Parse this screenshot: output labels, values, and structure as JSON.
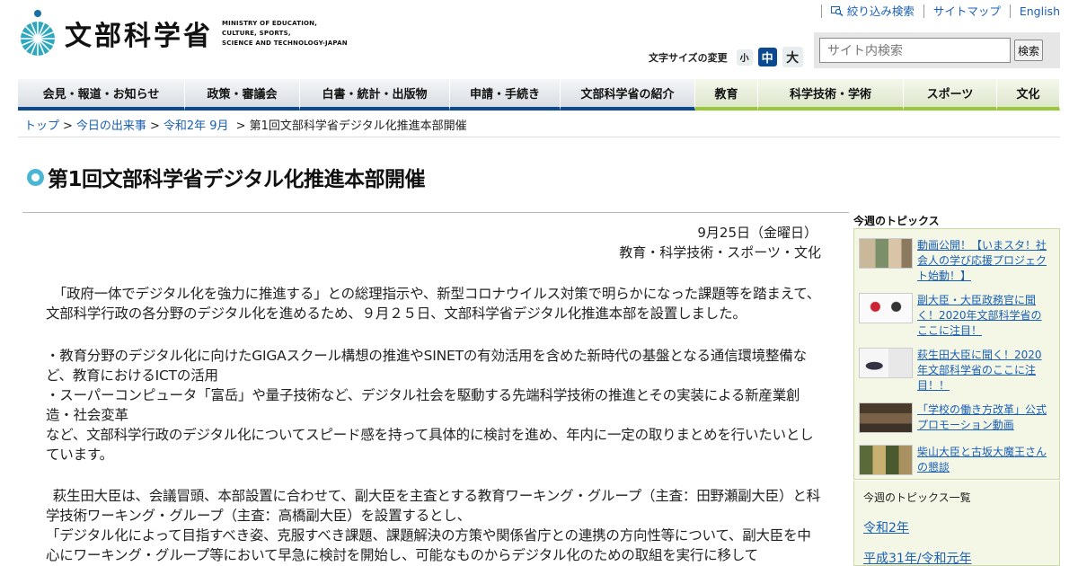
{
  "header": {
    "logo_text": "文部科学省",
    "logo_en_lines": [
      "MINISTRY OF EDUCATION,",
      "CULTURE, SPORTS,",
      "SCIENCE AND TECHNOLOGY-JAPAN"
    ],
    "util_links": {
      "filter_search": "絞り込み検索",
      "sitemap": "サイトマップ",
      "english": "English"
    },
    "font_size": {
      "label": "文字サイズの変更",
      "small": "小",
      "medium": "中",
      "large": "大"
    },
    "search": {
      "placeholder": "サイト内検索",
      "button": "検索"
    }
  },
  "nav": {
    "items": [
      "会見・報道・お知らせ",
      "政策・審議会",
      "白書・統計・出版物",
      "申請・手続き",
      "文部科学省の紹介",
      "教育",
      "科学技術・学術",
      "スポーツ",
      "文化"
    ]
  },
  "breadcrumb": {
    "items": [
      "トップ",
      "今日の出来事",
      "令和2年 9月"
    ],
    "current": "第1回文部科学省デジタル化推進本部開催"
  },
  "article": {
    "title": "第1回文部科学省デジタル化推進本部開催",
    "date": "9月25日（金曜日）",
    "category": "教育・科学技術・スポーツ・文化",
    "paragraph1": "「政府一体でデジタル化を強力に推進する」との総理指示や、新型コロナウイルス対策で明らかになった課題等を踏まえて、文部科学行政の各分野のデジタル化を進めるため、９月２５日、文部科学省デジタル化推進本部を設置しました。",
    "bullet1": "・教育分野のデジタル化に向けたGIGAスクール構想の推進やSINETの有効活用を含めた新時代の基盤となる通信環境整備など、教育におけるICTの活用",
    "bullet2": "・スーパーコンピュータ「富岳」や量子技術など、デジタル社会を駆動する先端科学技術の推進とその実装による新産業創造・社会変革",
    "bullet_tail": "など、文部科学行政のデジタル化についてスピード感を持って具体的に検討を進め、年内に一定の取りまとめを行いたいとしています。",
    "paragraph3_a": "萩生田大臣は、会議冒頭、本部設置に合わせて、副大臣を主査とする教育ワーキング・グループ（主査：田野瀬副大臣）と科学技術ワーキング・グループ（主査：高橋副大臣）を設置するとし、",
    "paragraph3_b": "「デジタル化によって目指すべき姿、克服すべき課題、課題解決の方策や関係省庁との連携の方向性等について、副大臣を中心にワーキング・グループ等において早急に検討を開始し、可能なものからデジタル化のための取組を実行に移して"
  },
  "sidebar": {
    "heading": "今週のトピックス",
    "topics": [
      "動画公開！【いまスタ！社会人の学び応援プロジェクト始動！】",
      "副大臣・大臣政務官に聞く！2020年文部科学省のここに注目！",
      "萩生田大臣に聞く！2020年文部科学省のここに注目！！",
      "「学校の働き方改革」公式プロモーション動画",
      "柴山大臣と古坂大魔王さんの懇談"
    ],
    "list_title": "今週のトピックス一覧",
    "years": [
      "令和2年",
      "平成31年/令和元年"
    ]
  }
}
